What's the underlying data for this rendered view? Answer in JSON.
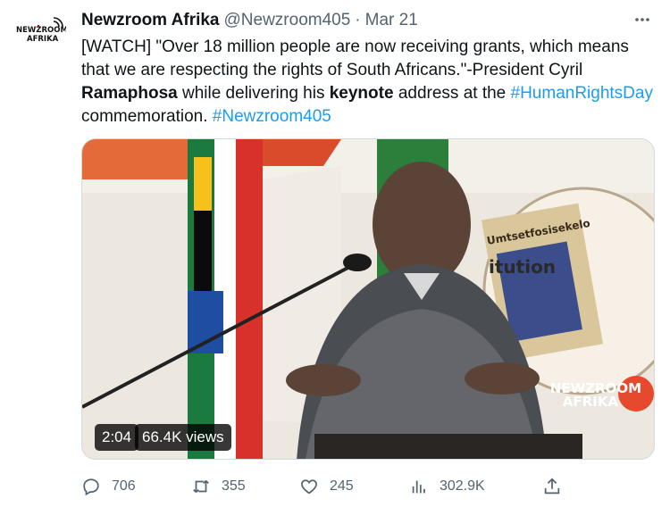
{
  "tweet": {
    "author_name": "Newzroom Afrika",
    "author_handle": "@Newzroom405",
    "separator": "·",
    "date": "Mar 21",
    "avatar_text": [
      "NEWZROOM",
      "AFRIKA"
    ],
    "text": {
      "p1": "[WATCH] \"Over 18 million people are now receiving grants, which means that we are respecting the rights of South Africans.\"-President Cyril ",
      "b1": "Ramaphosa",
      "p2": " while delivering his ",
      "b2": "keynote",
      "p3": " address at the ",
      "hashtag1": "#HumanRightsDay",
      "p4": " commemoration. ",
      "hashtag2": "#Newzroom405"
    }
  },
  "media": {
    "duration": "2:04",
    "views": "66.4K views",
    "watermark_line1": "NEWZROOM",
    "watermark_line2": "AFRIKA",
    "book_title": "Umtsetfosisekelo",
    "book_word": "itution"
  },
  "actions": {
    "replies": "706",
    "retweets": "355",
    "likes": "245",
    "views": "302.9K"
  },
  "colors": {
    "link": "#1d9bf0",
    "muted": "#536471",
    "text": "#0f1419"
  }
}
